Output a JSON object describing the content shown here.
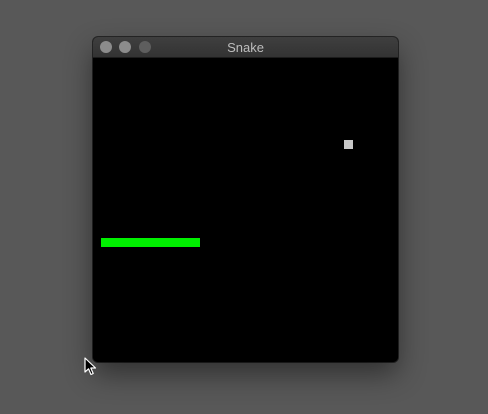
{
  "window": {
    "title": "Snake"
  },
  "game": {
    "snake_color": "#00f000",
    "food_color": "#c8c8c8",
    "background_color": "#000000"
  },
  "icons": {
    "close": "close-icon",
    "minimize": "minimize-icon",
    "zoom": "zoom-icon",
    "cursor": "mouse-pointer-icon"
  }
}
